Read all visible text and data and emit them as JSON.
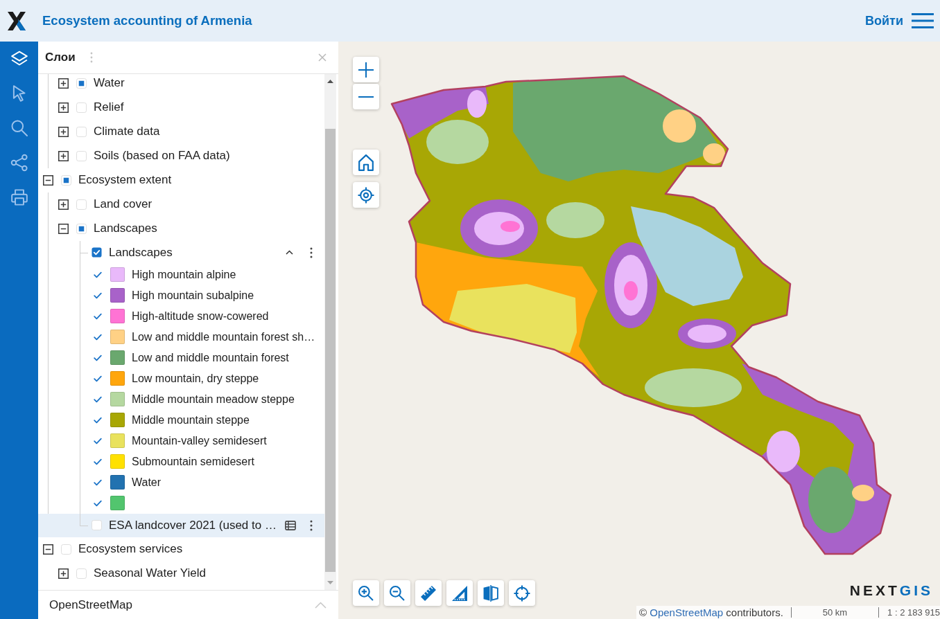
{
  "header": {
    "title": "Ecosystem accounting of Armenia",
    "login": "Войти"
  },
  "side_rail": [
    {
      "kind": "layers",
      "selected": true
    },
    {
      "kind": "select",
      "selected": false
    },
    {
      "kind": "search",
      "selected": false
    },
    {
      "kind": "share",
      "selected": false
    },
    {
      "kind": "print",
      "selected": false
    }
  ],
  "layers_panel": {
    "title": "Слои",
    "tree": [
      {
        "children": [
          {
            "kind": "group",
            "label": "Water",
            "expanded": false,
            "checked": false,
            "indeterminate": true
          },
          {
            "kind": "group",
            "label": "Relief",
            "expanded": false,
            "checked": false,
            "indeterminate": false
          },
          {
            "kind": "group",
            "label": "Climate data",
            "expanded": false,
            "checked": false,
            "indeterminate": false
          },
          {
            "kind": "group",
            "label": "Soils (based on FAA data)",
            "expanded": false,
            "checked": false,
            "indeterminate": false
          }
        ]
      },
      {
        "kind": "group",
        "label": "Ecosystem extent",
        "expanded": true,
        "checked": false,
        "indeterminate": true,
        "children": [
          {
            "kind": "group",
            "label": "Land cover",
            "expanded": false,
            "checked": false,
            "indeterminate": false
          },
          {
            "kind": "group",
            "label": "Landscapes",
            "expanded": true,
            "checked": false,
            "indeterminate": true,
            "children": [
              {
                "kind": "layer",
                "label": "Landscapes",
                "checked": true,
                "selected": false,
                "legend_expanded": true,
                "legend": [
                  {
                    "label": "High mountain alpine",
                    "color": "#e9b9fa",
                    "checked": true
                  },
                  {
                    "label": "High mountain subalpine",
                    "color": "#a862c9",
                    "checked": true
                  },
                  {
                    "label": "High-altitude snow-cowered",
                    "color": "#ff73d4",
                    "checked": true
                  },
                  {
                    "label": "Low and middle mountain forest sh…",
                    "color": "#ffd185",
                    "checked": true
                  },
                  {
                    "label": "Low and middle mountain forest",
                    "color": "#6aa86e",
                    "checked": true
                  },
                  {
                    "label": "Low mountain, dry steppe",
                    "color": "#ffa60d",
                    "checked": true
                  },
                  {
                    "label": "Middle mountain meadow steppe",
                    "color": "#b5d8a0",
                    "checked": true
                  },
                  {
                    "label": "Middle mountain steppe",
                    "color": "#a8a705",
                    "checked": true
                  },
                  {
                    "label": "Mountain-valley semidesert",
                    "color": "#e9e25d",
                    "checked": true
                  },
                  {
                    "label": "Submountain semidesert",
                    "color": "#ffe100",
                    "checked": true
                  },
                  {
                    "label": "Water",
                    "color": "#2272b0",
                    "checked": true
                  },
                  {
                    "color": "#52c56e",
                    "checked": true
                  }
                ]
              },
              {
                "kind": "layer",
                "label": "ESA landcover 2021 (used to …",
                "checked": false,
                "selected": true
              }
            ]
          }
        ]
      },
      {
        "kind": "group",
        "label": "Ecosystem services",
        "expanded": true,
        "checked": false,
        "indeterminate": false,
        "children": [
          {
            "kind": "group",
            "label": "Seasonal Water Yield",
            "expanded": false,
            "checked": false,
            "indeterminate": false
          }
        ]
      }
    ],
    "basemap": {
      "label": "OpenStreetMap",
      "expanded": false
    }
  },
  "map": {
    "attribution": {
      "symbol": "©",
      "link": "OpenStreetMap",
      "text": "contributors."
    },
    "scale": {
      "distance": "50 km",
      "ratio": "1 : 2 183 915"
    },
    "brand": "NEXTGIS"
  }
}
